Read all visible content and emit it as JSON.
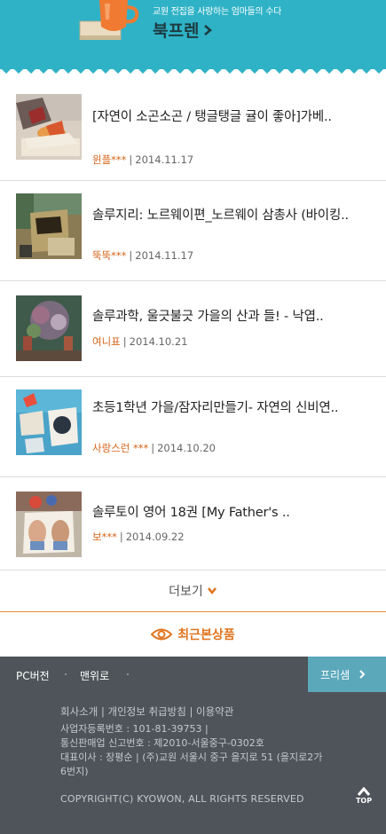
{
  "banner": {
    "subtitle": "교원 전집을 사랑하는 엄마들의 수다",
    "title": "북프렌",
    "bg_color": "#2fb2c6",
    "icon": "book-and-cup-illustration"
  },
  "posts": [
    {
      "title": "[자연이 소곤소곤 / 탱글탱글 귤이 좋아]가베..",
      "author": "윈플***",
      "date": "2014.11.17"
    },
    {
      "title": "솔루지리: 노르웨이편_노르웨이 삼총사 (바이킹..",
      "author": "뚝뚝***",
      "date": "2014.11.17"
    },
    {
      "title": "솔루과학, 울긋불긋 가을의 산과 들! - 낙엽..",
      "author": "여니표",
      "date": "2014.10.21"
    },
    {
      "title": "초등1학년 가을/잠자리만들기- 자연의 신비연..",
      "author": "사랑스런 ***",
      "date": "2014.10.20"
    },
    {
      "title": "솔루토이 영어 18권 [My Father's ..",
      "author": "보***",
      "date": "2014.09.22"
    }
  ],
  "more": {
    "label": "더보기",
    "icon": "chevron-down-icon"
  },
  "recent": {
    "label": "최근본상품",
    "icon": "eye-icon",
    "color": "#e0741e"
  },
  "footer": {
    "nav": {
      "pc": "PC버전",
      "top": "맨위로",
      "freesam": "프리샘"
    },
    "policies": "회사소개 | 개인정보 취급방침 | 이용약관",
    "company_lines": [
      "사업자등록번호 : 101-81-39753 |",
      "통신판매업 신고번호 : 제2010-서울중구-0302호",
      "대표이사 : 장평순 | (주)교원 서울시 중구 을지로 51 (을지로2가 6번지)"
    ],
    "copyright": "COPYRIGHT(C) KYOWON, ALL RIGHTS RESERVED",
    "top_label": "TOP",
    "bg_color": "#4e5459",
    "accent_color": "#5ba8bb"
  }
}
